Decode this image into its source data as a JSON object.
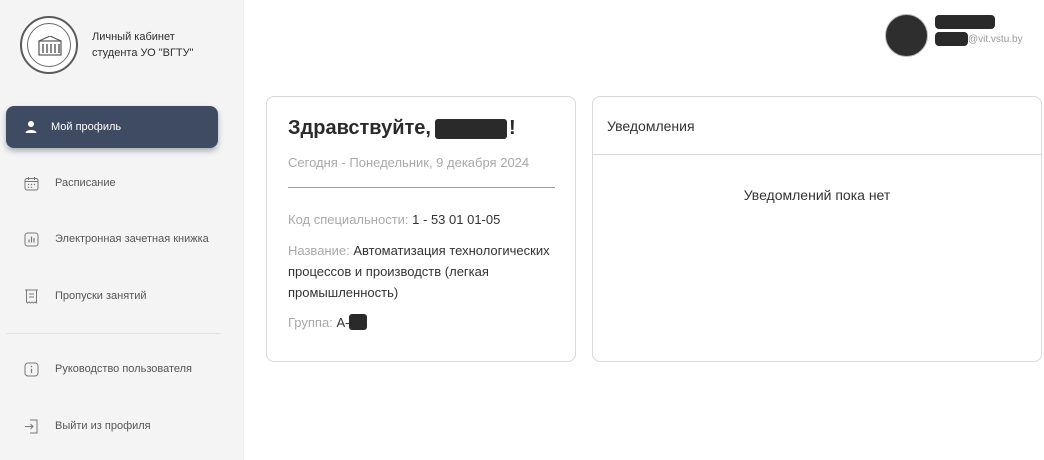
{
  "brand": {
    "line1": "Личный кабинет",
    "line2": "студента УО \"ВГТУ\""
  },
  "sidebar": {
    "items": [
      {
        "label": "Мой профиль",
        "icon": "user-icon",
        "active": true
      },
      {
        "label": "Расписание",
        "icon": "calendar-icon"
      },
      {
        "label": "Электронная зачетная книжка",
        "icon": "chart-icon"
      },
      {
        "label": "Пропуски занятий",
        "icon": "receipt-icon"
      },
      {
        "label": "Руководство пользователя",
        "icon": "info-icon"
      },
      {
        "label": "Выйти из профиля",
        "icon": "logout-icon"
      }
    ]
  },
  "user": {
    "email_suffix": "@vit.vstu.by"
  },
  "welcome": {
    "greeting": "Здравствуйте,",
    "greeting_end": "!",
    "date": "Сегодня - Понедельник, 9 декабря 2024",
    "spec_label": "Код специальности:",
    "spec_value": "1 - 53 01 01-05",
    "name_label": "Название:",
    "name_value": "Автоматизация технологических процессов и производств (легкая промышленность)",
    "group_label": "Группа:",
    "group_value": "А-"
  },
  "notifications": {
    "title": "Уведомления",
    "empty_text": "Уведомлений пока нет"
  },
  "colors": {
    "active_nav": "#3f4a63",
    "sidebar_bg": "#f4f4f5"
  }
}
